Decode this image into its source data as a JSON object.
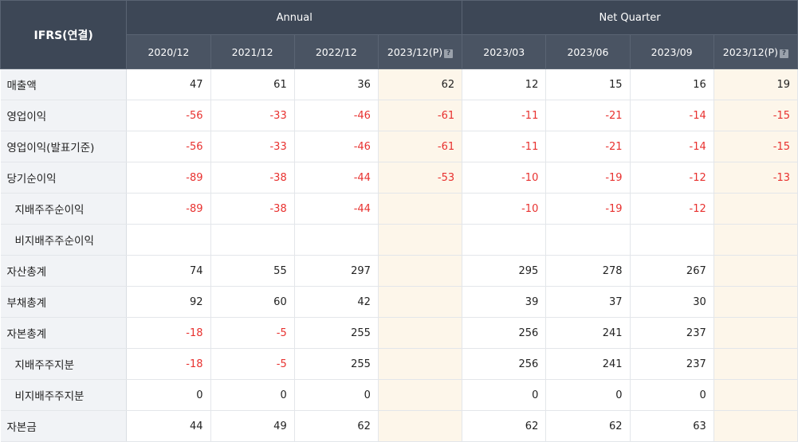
{
  "header": {
    "corner_label": "IFRS(연결)",
    "annual_label": "Annual",
    "quarter_label": "Net Quarter",
    "periods": [
      "2020/12",
      "2021/12",
      "2022/12",
      "2023/12(P)",
      "2023/03",
      "2023/06",
      "2023/09",
      "2023/12(P)"
    ],
    "info_icon_glyph": "?"
  },
  "rows": [
    {
      "label": "매출액",
      "values": [
        "47",
        "61",
        "36",
        "62",
        "12",
        "15",
        "16",
        "19"
      ]
    },
    {
      "label": "영업이익",
      "values": [
        "-56",
        "-33",
        "-46",
        "-61",
        "-11",
        "-21",
        "-14",
        "-15"
      ]
    },
    {
      "label": "영업이익(발표기준)",
      "values": [
        "-56",
        "-33",
        "-46",
        "-61",
        "-11",
        "-21",
        "-14",
        "-15"
      ]
    },
    {
      "label": "당기순이익",
      "values": [
        "-89",
        "-38",
        "-44",
        "-53",
        "-10",
        "-19",
        "-12",
        "-13"
      ]
    },
    {
      "label": "지배주주순이익",
      "values": [
        "-89",
        "-38",
        "-44",
        "",
        "-10",
        "-19",
        "-12",
        ""
      ]
    },
    {
      "label": "비지배주주순이익",
      "values": [
        "",
        "",
        "",
        "",
        "",
        "",
        "",
        ""
      ]
    },
    {
      "label": "자산총계",
      "values": [
        "74",
        "55",
        "297",
        "",
        "295",
        "278",
        "267",
        ""
      ]
    },
    {
      "label": "부채총계",
      "values": [
        "92",
        "60",
        "42",
        "",
        "39",
        "37",
        "30",
        ""
      ]
    },
    {
      "label": "자본총계",
      "values": [
        "-18",
        "-5",
        "255",
        "",
        "256",
        "241",
        "237",
        ""
      ]
    },
    {
      "label": "지배주주지분",
      "values": [
        "-18",
        "-5",
        "255",
        "",
        "256",
        "241",
        "237",
        ""
      ]
    },
    {
      "label": "비지배주주지분",
      "values": [
        "0",
        "0",
        "0",
        "",
        "0",
        "0",
        "0",
        ""
      ]
    },
    {
      "label": "자본금",
      "values": [
        "44",
        "49",
        "62",
        "",
        "62",
        "62",
        "63",
        ""
      ]
    }
  ],
  "colors": {
    "header_bg": "#3d4756",
    "negative": "#e8312f",
    "estimate_bg": "#fdf6ea",
    "label_bg": "#f1f3f6"
  }
}
